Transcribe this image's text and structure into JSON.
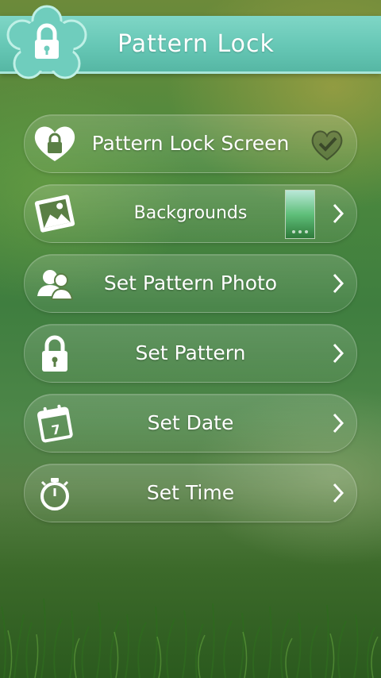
{
  "header": {
    "title": "Pattern Lock",
    "logo_icon": "padlock-icon"
  },
  "menu": [
    {
      "label": "Pattern Lock Screen",
      "icon": "heart-lock-icon",
      "accessory": "checkmark-icon"
    },
    {
      "label": "Backgrounds",
      "icon": "image-icon",
      "accessory": "chevron-right-icon"
    },
    {
      "label": "Set Pattern Photo",
      "icon": "users-icon",
      "accessory": "chevron-right-icon"
    },
    {
      "label": "Set Pattern",
      "icon": "padlock-icon",
      "accessory": "chevron-right-icon"
    },
    {
      "label": "Set Date",
      "icon": "calendar-icon",
      "accessory": "chevron-right-icon",
      "calendar_day": "7"
    },
    {
      "label": "Set Time",
      "icon": "stopwatch-icon",
      "accessory": "chevron-right-icon"
    }
  ],
  "colors": {
    "header": "#66c7b5",
    "text": "#ffffff"
  }
}
